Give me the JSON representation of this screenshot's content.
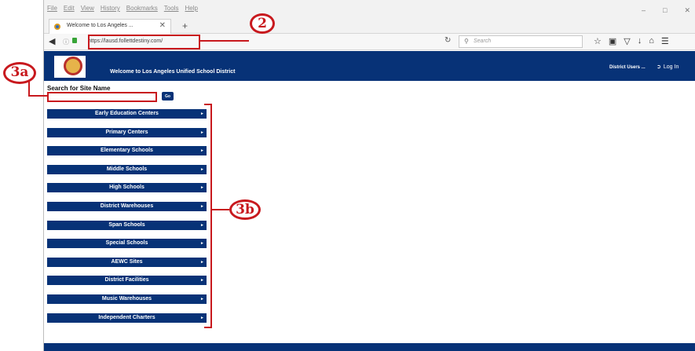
{
  "menubar": {
    "items": [
      "File",
      "Edit",
      "View",
      "History",
      "Bookmarks",
      "Tools",
      "Help"
    ],
    "controls": [
      "–",
      "□",
      "✕"
    ]
  },
  "tab": {
    "title": "Welcome to Los Angeles ...",
    "close": "✕",
    "new_tab": "+"
  },
  "navbar": {
    "url": "https://lausd.follettdestiny.com/",
    "search_placeholder": "Search"
  },
  "header": {
    "title": "Welcome to Los Angeles Unified School District",
    "district_users": "District Users ...",
    "login": "Log In"
  },
  "search": {
    "label": "Search for Site Name",
    "value": "",
    "go": "Go"
  },
  "categories": [
    "Early Education Centers",
    "Primary Centers",
    "Elementary Schools",
    "Middle Schools",
    "High Schools",
    "District Warehouses",
    "Span Schools",
    "Special Schools",
    "AEWC Sites",
    "District Facilities",
    "Music Warehouses",
    "Independent Charters"
  ],
  "callouts": {
    "url": "2",
    "search": "3a",
    "categories": "3b"
  },
  "colors": {
    "header_blue": "#073277",
    "callout_red": "#c8191e"
  }
}
